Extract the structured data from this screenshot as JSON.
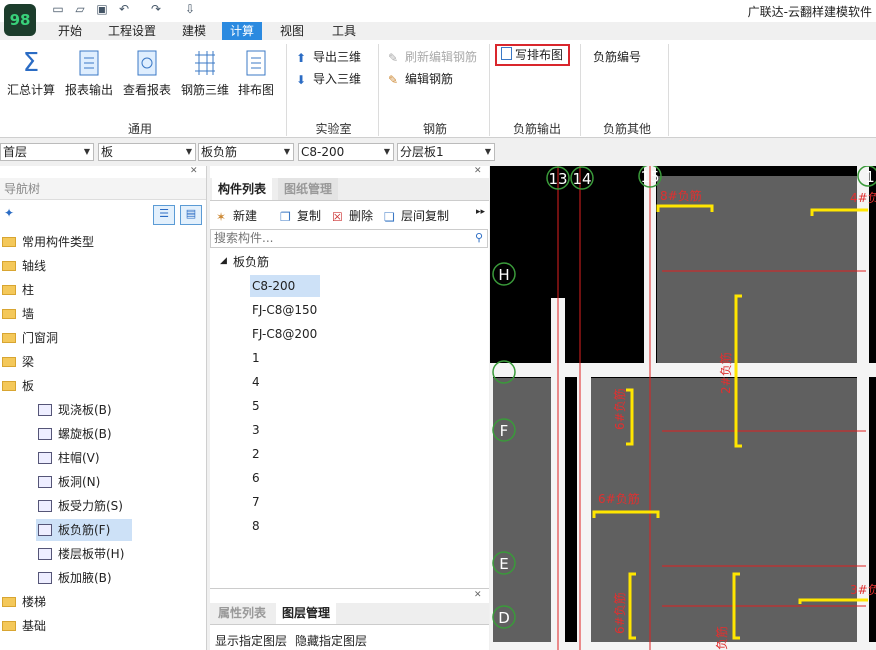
{
  "app": {
    "title": "广联达-云翻样建模软件",
    "logo": "98"
  },
  "quick_access": [
    "new-doc-icon",
    "open-folder-icon",
    "save-icon",
    "undo-icon",
    "redo-icon",
    "export-icon"
  ],
  "tabs": [
    "开始",
    "工程设置",
    "建模",
    "计算",
    "视图",
    "工具"
  ],
  "active_tab": "计算",
  "ribbon": {
    "general": {
      "buttons": [
        "汇总计算",
        "报表输出",
        "查看报表",
        "钢筋三维",
        "排布图"
      ],
      "group_label": "通用"
    },
    "lab": {
      "buttons": [
        "导出三维",
        "导入三维"
      ],
      "group_label": "实验室"
    },
    "rebar": {
      "buttons": [
        "刷新编辑钢筋",
        "编辑钢筋"
      ],
      "group_label": "钢筋"
    },
    "neg_output": {
      "buttons": [
        "写排布图"
      ],
      "group_label": "负筋输出"
    },
    "neg_other": {
      "buttons": [
        "负筋编号"
      ],
      "group_label": "负筋其他"
    }
  },
  "selectors": [
    "首层",
    "板",
    "板负筋",
    "C8-200",
    "分层板1"
  ],
  "nav": {
    "title": "导航树",
    "items": [
      "常用构件类型",
      "轴线",
      "柱",
      "墙",
      "门窗洞",
      "梁",
      "板"
    ],
    "slab_children": [
      "现浇板(B)",
      "螺旋板(B)",
      "柱帽(V)",
      "板洞(N)",
      "板受力筋(S)",
      "板负筋(F)",
      "楼层板带(H)",
      "板加腋(B)"
    ],
    "selected_child": "板负筋(F)",
    "bottom_items": [
      "楼梯",
      "基础"
    ]
  },
  "component_panel": {
    "tabs": [
      "构件列表",
      "图纸管理"
    ],
    "toolbar": [
      "新建",
      "复制",
      "删除",
      "层间复制"
    ],
    "search_placeholder": "搜索构件...",
    "root": "板负筋",
    "items": [
      "C8-200",
      "FJ-C8@150",
      "FJ-C8@200",
      "1",
      "4",
      "5",
      "3",
      "2",
      "6",
      "7",
      "8"
    ],
    "selected_item": "C8-200"
  },
  "bottom_panel": {
    "tabs": [
      "属性列表",
      "图层管理"
    ],
    "actions": [
      "显示指定图层",
      "隐藏指定图层"
    ]
  },
  "canvas": {
    "axis_numbers": [
      "13",
      "14",
      "15",
      "1"
    ],
    "axis_letters": [
      "H",
      "F",
      "E",
      "D"
    ],
    "labels": [
      "8#负筋",
      "4#负",
      "2#负筋",
      "6#负筋",
      "6#负筋",
      "3#负",
      "6#负筋",
      "负筋"
    ]
  }
}
